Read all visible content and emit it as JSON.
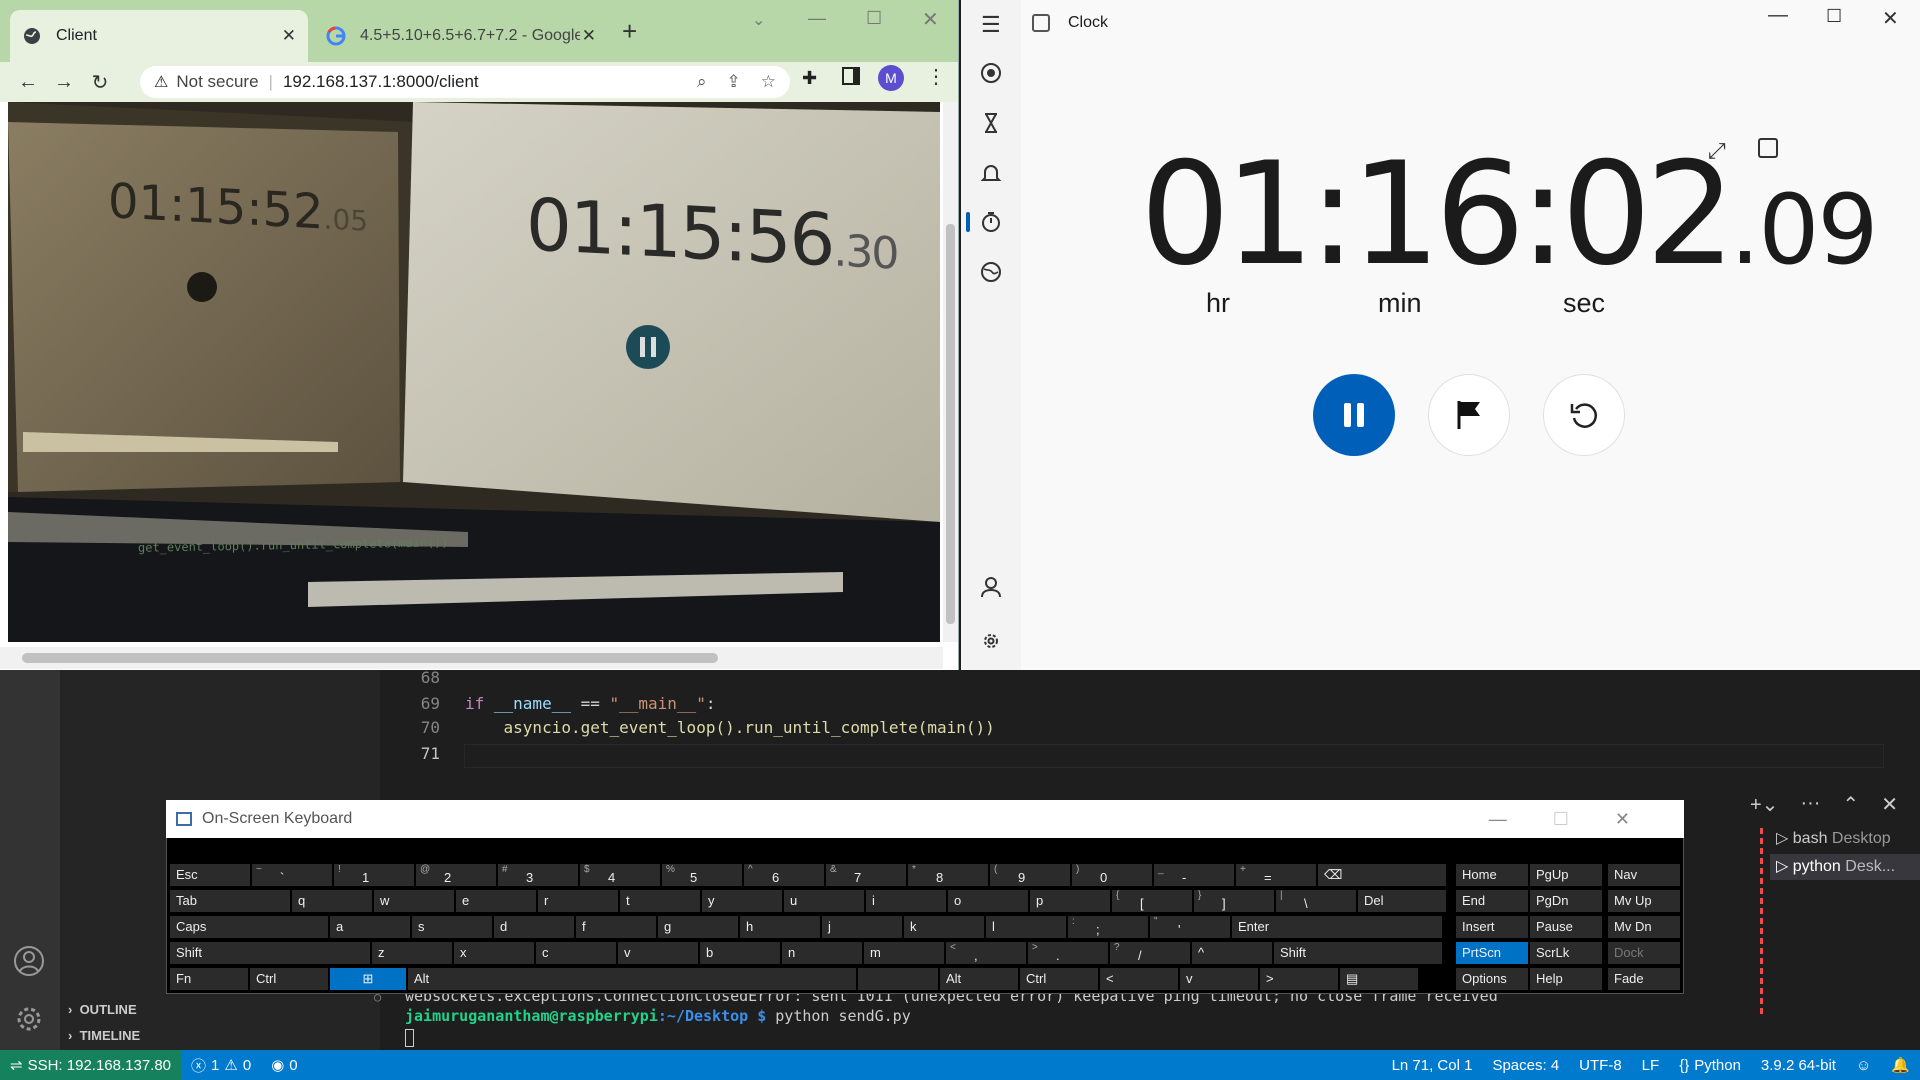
{
  "browser": {
    "tabs": [
      {
        "title": "Client"
      },
      {
        "title": "4.5+5.10+6.5+6.7+7.2 - Google S"
      }
    ],
    "address": {
      "security": "Not secure",
      "url": "192.168.137.1:8000/client"
    },
    "profile_initial": "M",
    "webcam": {
      "left_time": "01:15:52",
      "left_centis": ".05",
      "right_time": "01:15:56",
      "right_centis": ".30",
      "code_text": "get_event_loop().run_until_complete(main())"
    }
  },
  "clock": {
    "title": "Clock",
    "hours": "01",
    "minutes": "16",
    "seconds": "02",
    "centis": ".09",
    "units": {
      "hr": "hr",
      "min": "min",
      "sec": "sec"
    }
  },
  "editor": {
    "lines": [
      {
        "num": "68",
        "text": ""
      },
      {
        "num": "69",
        "kw": "if",
        "a": " __name__ ",
        "op": "==",
        "s": " \"__main__\"",
        "e": ":"
      },
      {
        "num": "70",
        "text": "    asyncio.get_event_loop().run_until_complete(main())"
      },
      {
        "num": "71",
        "text": ""
      }
    ]
  },
  "terminal": {
    "error": "websockets.exceptions.ConnectionClosedError: sent 1011 (unexpected error) keepalive ping timeout; no close frame received",
    "prompt_user": "jaimuruganantham@raspberrypi",
    "prompt_path": ":~/Desktop $",
    "command": " python sendG.py",
    "tabs": [
      {
        "name": "bash",
        "desc": "Desktop"
      },
      {
        "name": "python",
        "desc": "Desk..."
      }
    ]
  },
  "sidebar": {
    "outline": "OUTLINE",
    "timeline": "TIMELINE"
  },
  "osk": {
    "title": "On-Screen Keyboard",
    "rows": [
      [
        "Esc",
        "~ `",
        "! 1",
        "@ 2",
        "# 3",
        "$ 4",
        "% 5",
        "^ 6",
        "& 7",
        "* 8",
        "( 9",
        ") 0",
        "_ -",
        "+ =",
        "⌫"
      ],
      [
        "Tab",
        "q",
        "w",
        "e",
        "r",
        "t",
        "y",
        "u",
        "i",
        "o",
        "p",
        "{ [",
        "} ]",
        "| \\",
        "Del"
      ],
      [
        "Caps",
        "a",
        "s",
        "d",
        "f",
        "g",
        "h",
        "j",
        "k",
        "l",
        ": ;",
        "\" '",
        "Enter"
      ],
      [
        "Shift",
        "z",
        "x",
        "c",
        "v",
        "b",
        "n",
        "m",
        "< ,",
        "> .",
        "? /",
        "^",
        "Shift"
      ],
      [
        "Fn",
        "Ctrl",
        "⊞",
        "Alt",
        "",
        "Alt",
        "Ctrl",
        "<",
        "v",
        ">",
        "▤"
      ]
    ],
    "nav": [
      [
        "Home",
        "PgUp",
        "Nav"
      ],
      [
        "End",
        "PgDn",
        "Mv Up"
      ],
      [
        "Insert",
        "Pause",
        "Mv Dn"
      ],
      [
        "PrtScn",
        "ScrLk",
        "Dock"
      ],
      [
        "Options",
        "Help",
        "Fade"
      ]
    ]
  },
  "status": {
    "remote": "SSH: 192.168.137.80",
    "errors": "1",
    "warnings": "0",
    "ports": "0",
    "position": "Ln 71, Col 1",
    "spaces": "Spaces: 4",
    "encoding": "UTF-8",
    "eol": "LF",
    "language": "Python",
    "interpreter": "3.9.2 64-bit"
  },
  "colors": {
    "accent": "#005fb8",
    "vscode_status": "#007acc",
    "osk_active": "#0072c6"
  }
}
